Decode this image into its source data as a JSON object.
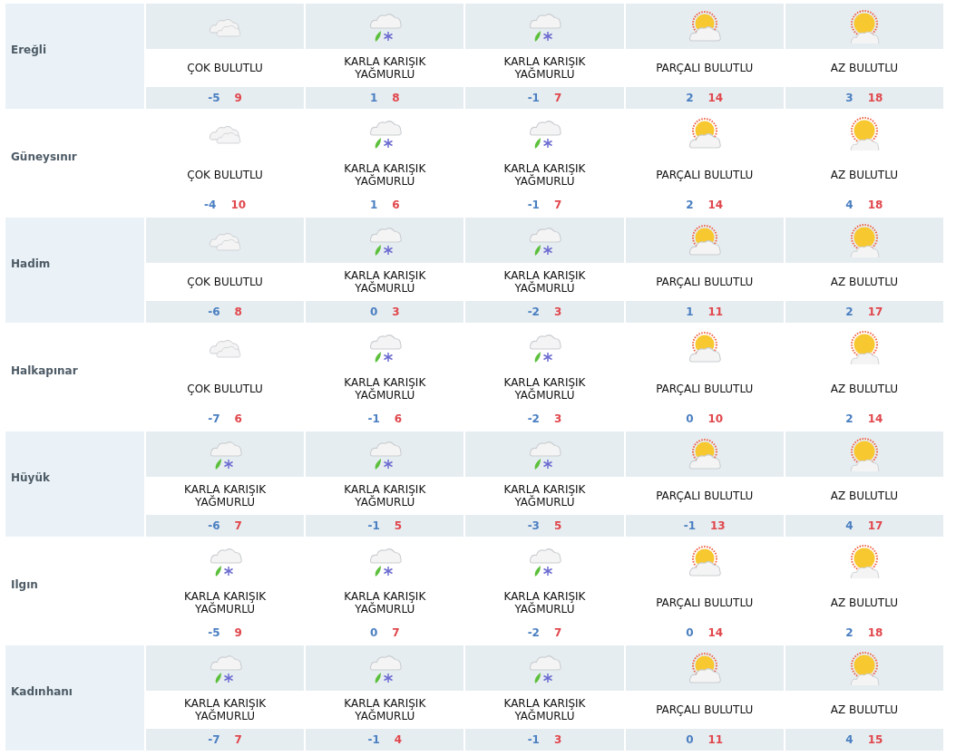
{
  "cities": [
    {
      "name": "Ereğli",
      "days": [
        {
          "kind": "cloudy",
          "condition": "ÇOK BULUTLU",
          "low": "-5",
          "high": "9"
        },
        {
          "kind": "sleet",
          "condition": "KARLA KARIŞIK YAĞMURLU",
          "low": "1",
          "high": "8"
        },
        {
          "kind": "sleet",
          "condition": "KARLA KARIŞIK YAĞMURLU",
          "low": "-1",
          "high": "7"
        },
        {
          "kind": "partly",
          "condition": "PARÇALI BULUTLU",
          "low": "2",
          "high": "14"
        },
        {
          "kind": "sunny",
          "condition": "AZ BULUTLU",
          "low": "3",
          "high": "18"
        }
      ]
    },
    {
      "name": "Güneysınır",
      "days": [
        {
          "kind": "cloudy",
          "condition": "ÇOK BULUTLU",
          "low": "-4",
          "high": "10"
        },
        {
          "kind": "sleet",
          "condition": "KARLA KARIŞIK YAĞMURLU",
          "low": "1",
          "high": "6"
        },
        {
          "kind": "sleet",
          "condition": "KARLA KARIŞIK YAĞMURLU",
          "low": "-1",
          "high": "7"
        },
        {
          "kind": "partly",
          "condition": "PARÇALI BULUTLU",
          "low": "2",
          "high": "14"
        },
        {
          "kind": "sunny",
          "condition": "AZ BULUTLU",
          "low": "4",
          "high": "18"
        }
      ]
    },
    {
      "name": "Hadim",
      "days": [
        {
          "kind": "cloudy",
          "condition": "ÇOK BULUTLU",
          "low": "-6",
          "high": "8"
        },
        {
          "kind": "sleet",
          "condition": "KARLA KARIŞIK YAĞMURLU",
          "low": "0",
          "high": "3"
        },
        {
          "kind": "sleet",
          "condition": "KARLA KARIŞIK YAĞMURLU",
          "low": "-2",
          "high": "3"
        },
        {
          "kind": "partly",
          "condition": "PARÇALI BULUTLU",
          "low": "1",
          "high": "11"
        },
        {
          "kind": "sunny",
          "condition": "AZ BULUTLU",
          "low": "2",
          "high": "17"
        }
      ]
    },
    {
      "name": "Halkapınar",
      "days": [
        {
          "kind": "cloudy",
          "condition": "ÇOK BULUTLU",
          "low": "-7",
          "high": "6"
        },
        {
          "kind": "sleet",
          "condition": "KARLA KARIŞIK YAĞMURLU",
          "low": "-1",
          "high": "6"
        },
        {
          "kind": "sleet",
          "condition": "KARLA KARIŞIK YAĞMURLU",
          "low": "-2",
          "high": "3"
        },
        {
          "kind": "partly",
          "condition": "PARÇALI BULUTLU",
          "low": "0",
          "high": "10"
        },
        {
          "kind": "sunny",
          "condition": "AZ BULUTLU",
          "low": "2",
          "high": "14"
        }
      ]
    },
    {
      "name": "Hüyük",
      "days": [
        {
          "kind": "sleet",
          "condition": "KARLA KARIŞIK YAĞMURLU",
          "low": "-6",
          "high": "7"
        },
        {
          "kind": "sleet",
          "condition": "KARLA KARIŞIK YAĞMURLU",
          "low": "-1",
          "high": "5"
        },
        {
          "kind": "sleet",
          "condition": "KARLA KARIŞIK YAĞMURLU",
          "low": "-3",
          "high": "5"
        },
        {
          "kind": "partly",
          "condition": "PARÇALI BULUTLU",
          "low": "-1",
          "high": "13"
        },
        {
          "kind": "sunny",
          "condition": "AZ BULUTLU",
          "low": "4",
          "high": "17"
        }
      ]
    },
    {
      "name": "Ilgın",
      "days": [
        {
          "kind": "sleet",
          "condition": "KARLA KARIŞIK YAĞMURLU",
          "low": "-5",
          "high": "9"
        },
        {
          "kind": "sleet",
          "condition": "KARLA KARIŞIK YAĞMURLU",
          "low": "0",
          "high": "7"
        },
        {
          "kind": "sleet",
          "condition": "KARLA KARIŞIK YAĞMURLU",
          "low": "-2",
          "high": "7"
        },
        {
          "kind": "partly",
          "condition": "PARÇALI BULUTLU",
          "low": "0",
          "high": "14"
        },
        {
          "kind": "sunny",
          "condition": "AZ BULUTLU",
          "low": "2",
          "high": "18"
        }
      ]
    },
    {
      "name": "Kadınhanı",
      "days": [
        {
          "kind": "sleet",
          "condition": "KARLA KARIŞIK YAĞMURLU",
          "low": "-7",
          "high": "7"
        },
        {
          "kind": "sleet",
          "condition": "KARLA KARIŞIK YAĞMURLU",
          "low": "-1",
          "high": "4"
        },
        {
          "kind": "sleet",
          "condition": "KARLA KARIŞIK YAĞMURLU",
          "low": "-1",
          "high": "3"
        },
        {
          "kind": "partly",
          "condition": "PARÇALI BULUTLU",
          "low": "0",
          "high": "11"
        },
        {
          "kind": "sunny",
          "condition": "AZ BULUTLU",
          "low": "4",
          "high": "15"
        }
      ]
    }
  ]
}
